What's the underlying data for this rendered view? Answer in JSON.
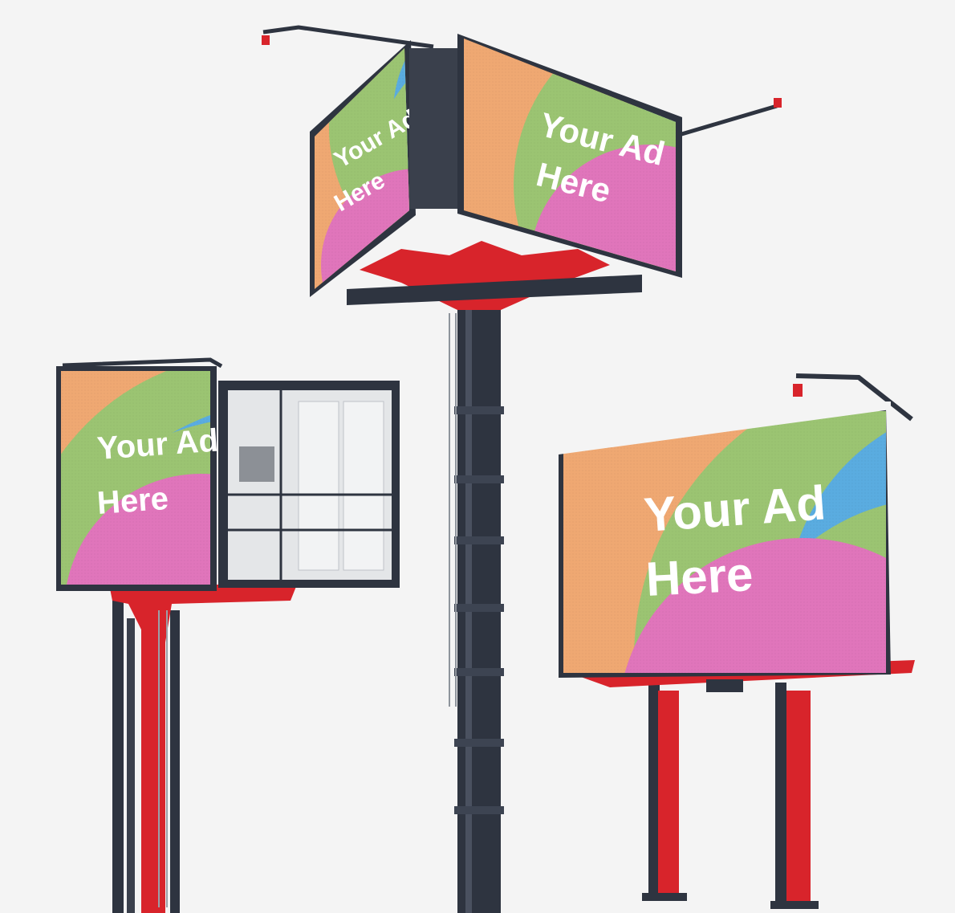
{
  "scene": {
    "background_color": "#f4f4f4",
    "frame_color": "#2e3440",
    "support_red": "#d8242b",
    "screen_colors": {
      "orange": "#efa872",
      "green": "#9bc472",
      "blue": "#5aace0",
      "pink": "#e075bb"
    }
  },
  "billboards": {
    "left": {
      "line1": "Your Ad",
      "line2": "Here"
    },
    "center_left_face": {
      "line1": "Your Ad",
      "line2": "Here"
    },
    "center_right_face": {
      "line1": "Your Ad",
      "line2": "Here"
    },
    "right": {
      "line1": "Your Ad",
      "line2": "Here"
    }
  }
}
